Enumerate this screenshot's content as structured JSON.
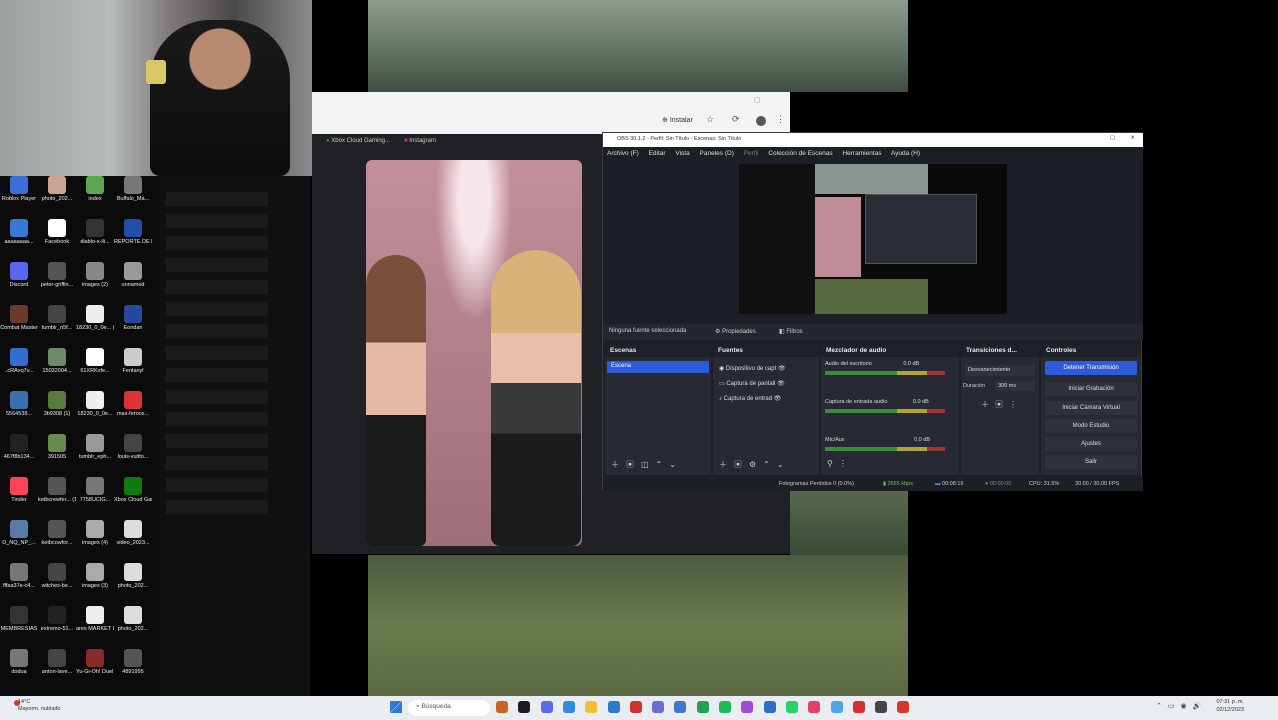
{
  "desktop": {
    "icons": [
      {
        "label": "Roblox Player",
        "color": "#3b6fd8"
      },
      {
        "label": "photo_202...",
        "color": "#c9a58f"
      },
      {
        "label": "index",
        "color": "#5da84e"
      },
      {
        "label": "Buffalo_Ma...",
        "color": "#777"
      },
      {
        "label": "aaaaaaaa...",
        "color": "#3a78d6"
      },
      {
        "label": "Facebook",
        "color": "#ffffff"
      },
      {
        "label": "diablo-x-ili...",
        "color": "#333"
      },
      {
        "label": "REPORTE DE REVISION D...",
        "color": "#1f4fa8"
      },
      {
        "label": "Discord",
        "color": "#5865f2"
      },
      {
        "label": "peter-griffin...",
        "color": "#555"
      },
      {
        "label": "images (2)",
        "color": "#888"
      },
      {
        "label": "unnamed",
        "color": "#999"
      },
      {
        "label": "Combat Master",
        "color": "#6b3b2a"
      },
      {
        "label": "tumblr_n5f...",
        "color": "#444"
      },
      {
        "label": "18230_0_0e... (1)",
        "color": "#eee"
      },
      {
        "label": "Eondan",
        "color": "#2449a0"
      },
      {
        "label": "..cRAxq7v...",
        "color": "#2f6fd2"
      },
      {
        "label": "15032004...",
        "color": "#6c8a6a"
      },
      {
        "label": "61XRKxfe...",
        "color": "#fff"
      },
      {
        "label": "Fentanyl",
        "color": "#ccc"
      },
      {
        "label": "5564538...",
        "color": "#3a6fb0"
      },
      {
        "label": "3b9308 (1)",
        "color": "#5b7a3e"
      },
      {
        "label": "18230_0_0e...",
        "color": "#eee"
      },
      {
        "label": "max-feroce...",
        "color": "#d33"
      },
      {
        "label": "467f8b134...",
        "color": "#222"
      },
      {
        "label": "391505",
        "color": "#6a8a4e"
      },
      {
        "label": "tumblr_eph...",
        "color": "#999"
      },
      {
        "label": "louis-vuitto...",
        "color": "#444"
      },
      {
        "label": "Tinder",
        "color": "#ff4458"
      },
      {
        "label": "ketbcrewfer... (1)",
        "color": "#555"
      },
      {
        "label": "7758UCIG...",
        "color": "#777"
      },
      {
        "label": "Xbox Cloud Gaming",
        "color": "#107c10"
      },
      {
        "label": "D_NQ_NP_...",
        "color": "#5a7aa8"
      },
      {
        "label": "ketbcowfor...",
        "color": "#555"
      },
      {
        "label": "images (4)",
        "color": "#aaa"
      },
      {
        "label": "video_2023...",
        "color": "#ddd"
      },
      {
        "label": "fffaa37e-c4...",
        "color": "#777"
      },
      {
        "label": "witches-be...",
        "color": "#444"
      },
      {
        "label": "images (3)",
        "color": "#aaa"
      },
      {
        "label": "photo_202...",
        "color": "#ddd"
      },
      {
        "label": "MEMBRESIAS",
        "color": "#333"
      },
      {
        "label": "extremo-51...",
        "color": "#222"
      },
      {
        "label": "ares MARKET LINK UPDA...",
        "color": "#eee"
      },
      {
        "label": "photo_202...",
        "color": "#ddd"
      },
      {
        "label": "dodua",
        "color": "#777"
      },
      {
        "label": "anton-lave...",
        "color": "#444"
      },
      {
        "label": "Yu-Gi-Oh! Duel Links",
        "color": "#8a2a2a"
      },
      {
        "label": "4891995",
        "color": "#555"
      }
    ]
  },
  "chrome": {
    "install_label": "Instalar",
    "tabs": [
      "Xbox Cloud Gaming...",
      "Instagram"
    ]
  },
  "obs": {
    "title": "OBS 30.1.2 - Perfil: Sin Título - Escenas: Sin Título",
    "menu": [
      "Archivo (F)",
      "Editar",
      "Vista",
      "Paneles (D)",
      "Perfil",
      "Colección de Escenas",
      "Herramientas",
      "Ayuda (H)"
    ],
    "no_source": "Ninguna fuente seleccionada",
    "properties": "Propiedades",
    "filters": "Filtros",
    "docks": {
      "scenes": {
        "title": "Escenas",
        "items": [
          "Escena"
        ]
      },
      "sources": {
        "title": "Fuentes",
        "items": [
          "Dispositivo de capt",
          "Captura de pantall",
          "Captura de entrad"
        ]
      },
      "mixer": {
        "title": "Mezclador de audio",
        "channels": [
          {
            "name": "Audio del escritorio",
            "db": "0.0 dB"
          },
          {
            "name": "Captura de entrada audio",
            "db": "0.0 dB"
          },
          {
            "name": "Mic/Aux",
            "db": "0.0 dB"
          }
        ]
      },
      "transitions": {
        "title": "Transiciones d...",
        "mode": "Desvanecimiento",
        "duration_label": "Duración",
        "duration_value": "300 ms"
      },
      "controls": {
        "title": "Controles",
        "buttons": [
          "Detener Transmisión",
          "Iniciar Grabación",
          "Iniciar Cámara Virtual",
          "Modo Estudio",
          "Ajustes",
          "Salir"
        ]
      }
    },
    "status": {
      "dropped": "Fotogramas Perdidos 0 (0.0%)",
      "bitrate": "2665 kbps",
      "live_time": "00:08:19",
      "rec_time": "00:00:00",
      "cpu": "CPU: 31.5%",
      "fps": "30.00 / 30.00 FPS"
    }
  },
  "taskbar": {
    "search_placeholder": "Búsqueda",
    "weather_temp": "14°C",
    "weather_desc": "Mayorm. nublado",
    "time": "07:31 p. m.",
    "date": "02/12/2023"
  }
}
